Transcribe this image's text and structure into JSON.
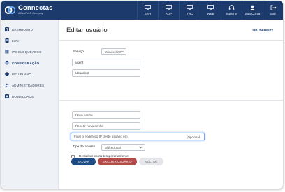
{
  "brand": {
    "title": "Connectas",
    "subtitle": "A BluePex® Company"
  },
  "nav": [
    {
      "label": "SSH",
      "icon": "monitor-icon"
    },
    {
      "label": "RDP",
      "icon": "monitor-icon"
    },
    {
      "label": "VNC",
      "icon": "monitor-icon"
    },
    {
      "label": "WEB",
      "icon": "monitor-icon"
    },
    {
      "label": "Suporte",
      "icon": "support-icon"
    },
    {
      "label": "Sua Conta",
      "icon": "user-icon"
    },
    {
      "label": "Sair",
      "icon": "logout-icon"
    }
  ],
  "sidebar": {
    "items": [
      {
        "label": "DASHBOARD",
        "icon": "dashboard-icon"
      },
      {
        "label": "LOG",
        "icon": "log-icon"
      },
      {
        "label": "IPS BLOQUEADOS",
        "icon": "blocked-ip-icon"
      },
      {
        "label": "CONFIGURAÇÃO",
        "icon": "gear-icon",
        "active": true
      },
      {
        "label": "MEU PLANO",
        "icon": "plan-icon"
      },
      {
        "label": "ADMINISTRADORES",
        "icon": "admins-icon"
      },
      {
        "label": "DOWNLOADS",
        "icon": "download-icon"
      }
    ]
  },
  "page": {
    "title": "Editar usuário",
    "brand_tag": "Ob. BluePex"
  },
  "form": {
    "service_label": "Serviço",
    "service_value": "Monovoltiro",
    "username_value": "user2",
    "fullname_value": "Usuário 2",
    "new_password_placeholder": "Nova senha",
    "repeat_password_placeholder": "Repetir nova senha",
    "ip_placeholder": "Fixar o endereço IP deste usuário em",
    "ip_suffix": "(Opcional)",
    "access_type_label": "Tipo de acesso",
    "access_type_value": "Bidirecional",
    "disable_label": "Desativar conta temporariamente"
  },
  "buttons": {
    "save": "SALVAR",
    "delete": "EXCLUIR USUÁRIO",
    "back": "VOLTAR"
  },
  "colors": {
    "topbar": "#1c3a6b",
    "primary_button": "#1f4a82",
    "danger_button": "#b54a4a",
    "secondary_button": "#e4e6ea"
  }
}
